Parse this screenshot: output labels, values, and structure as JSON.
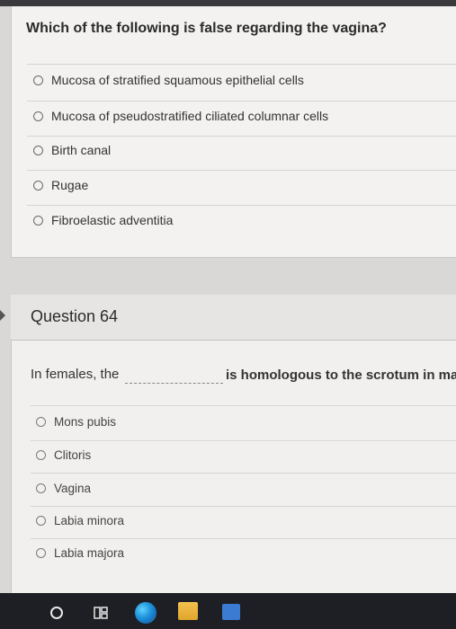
{
  "question_previous": {
    "text": "Which of the following is false regarding the vagina?",
    "options": [
      "Mucosa of stratified squamous epithelial cells",
      "Mucosa of pseudostratified ciliated columnar cells",
      "Birth canal",
      "Rugae",
      "Fibroelastic adventitia"
    ]
  },
  "question_64": {
    "title": "Question 64",
    "prefix": "In females, the",
    "suffix": "is homologous to the scrotum in male",
    "options": [
      "Mons pubis",
      "Clitoris",
      "Vagina",
      "Labia minora",
      "Labia majora"
    ]
  },
  "taskbar": {
    "icons": [
      "search-icon",
      "task-view-icon",
      "edge-browser-icon",
      "file-explorer-icon",
      "store-icon"
    ]
  },
  "colors": {
    "card_background": "#f3f2f0",
    "page_background": "#d9d8d6",
    "taskbar": "#1e1f24",
    "top_band": "#3a3a3c"
  }
}
